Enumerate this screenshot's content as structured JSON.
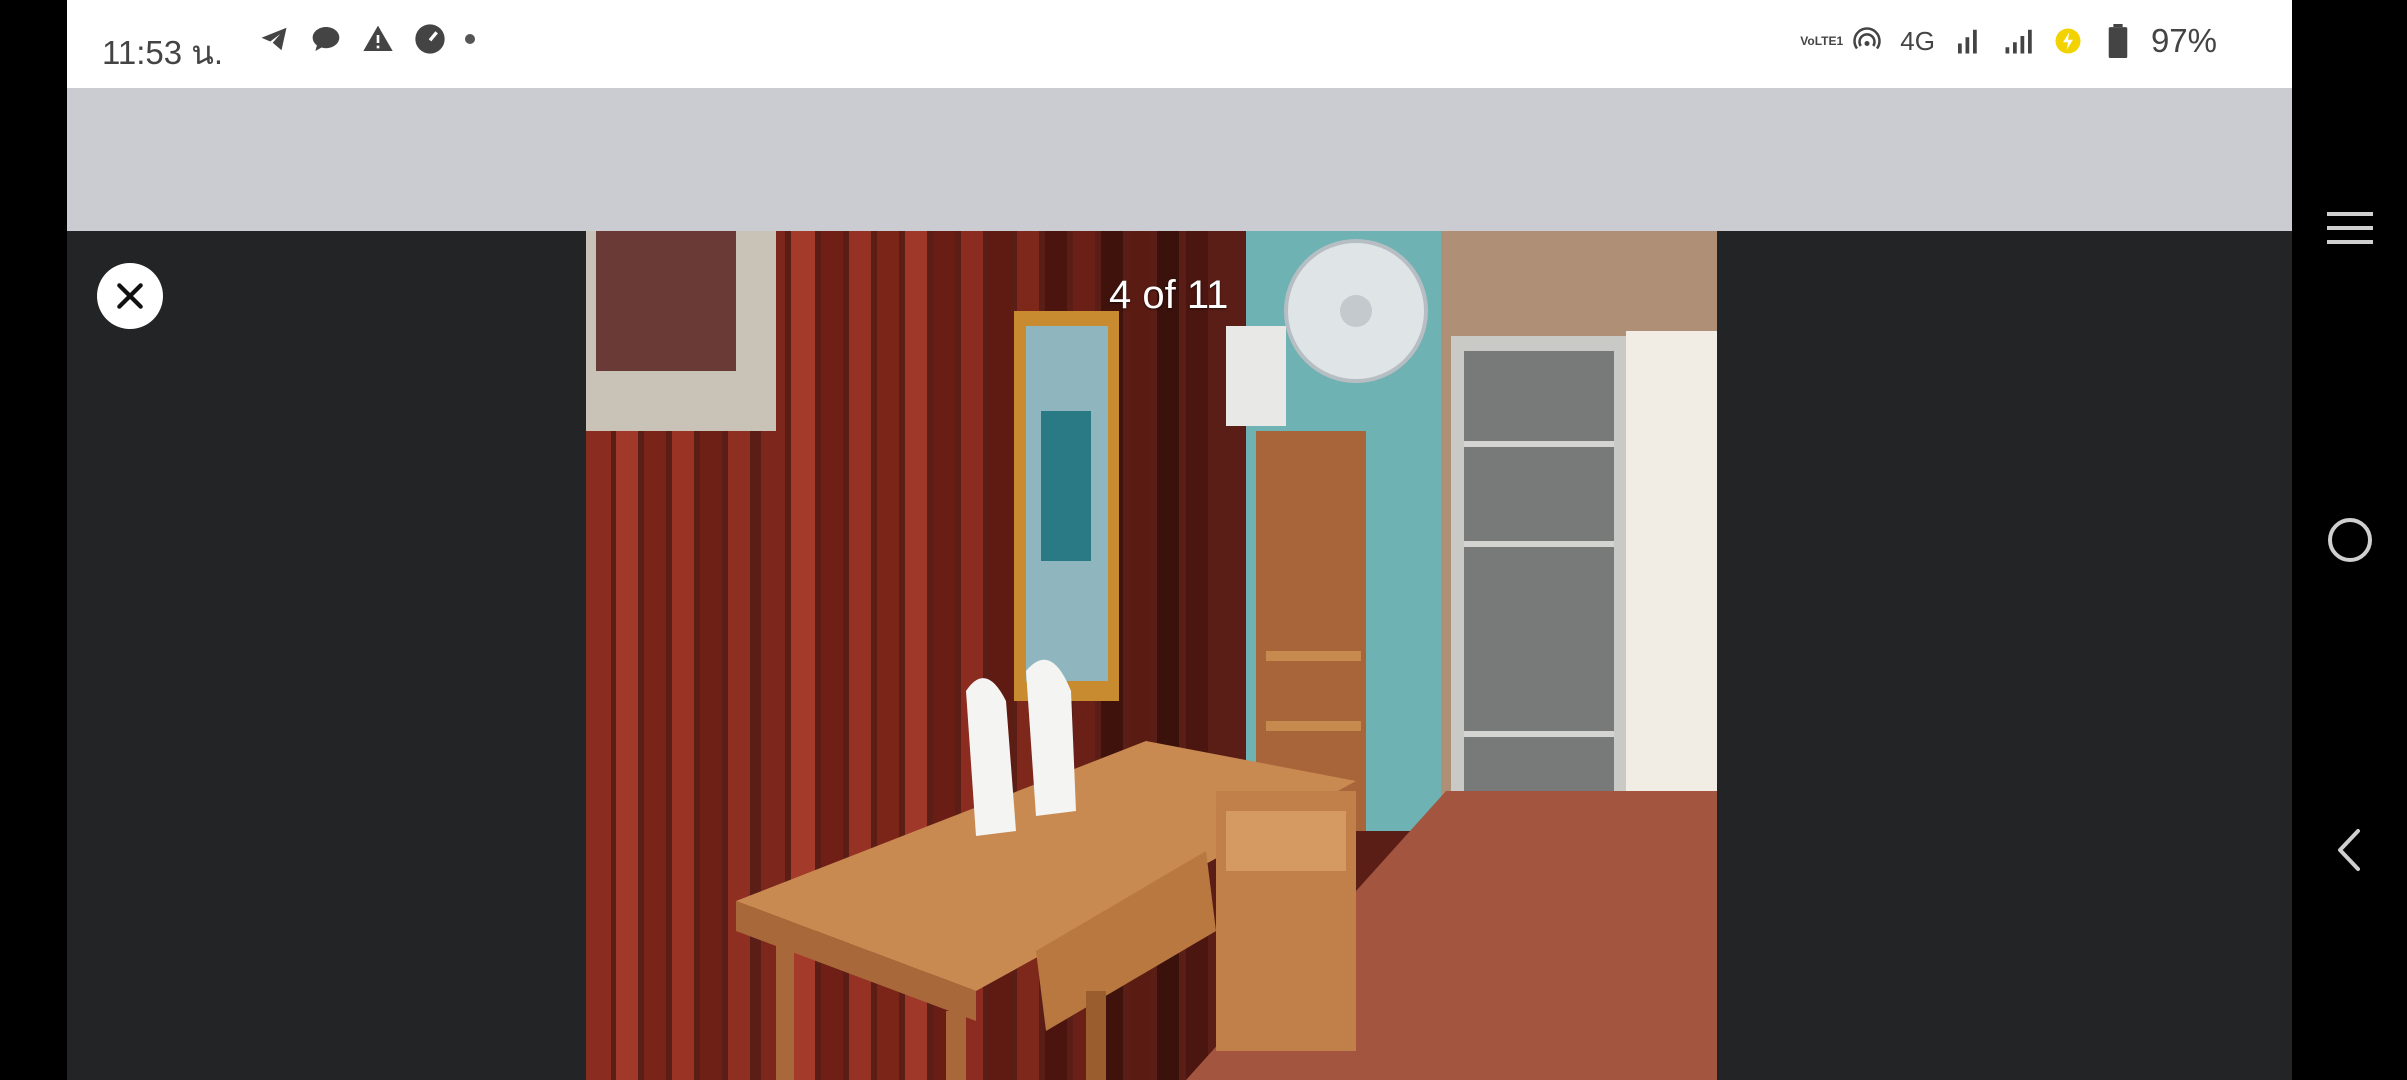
{
  "status_bar": {
    "time": "11:53 น.",
    "battery_percent": "97%",
    "network_label": "4G",
    "lte_label": "VoLTE1"
  },
  "viewer": {
    "counter": "4 of 11",
    "current_index": 4,
    "total": 11
  },
  "icons": {
    "close": "close-icon",
    "menu": "menu-icon",
    "home": "home-icon",
    "back": "back-icon"
  },
  "colors": {
    "gray_band": "#cbccd1",
    "viewer_bg": "#232426"
  }
}
